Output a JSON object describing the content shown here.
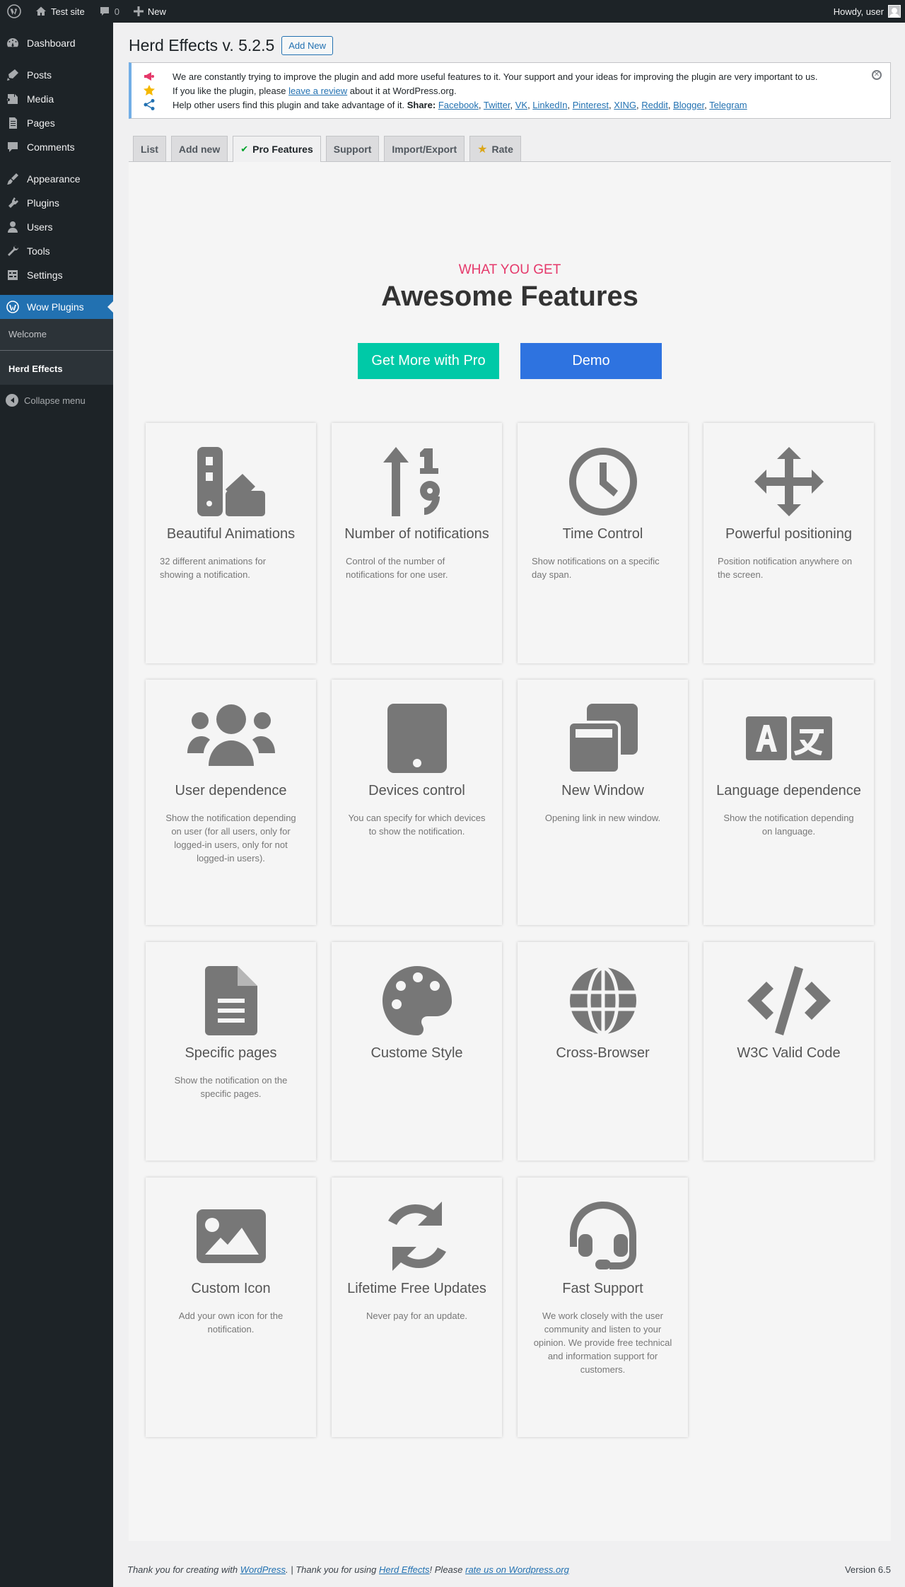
{
  "adminbar": {
    "site_name": "Test site",
    "comments_count": "0",
    "new_label": "New",
    "howdy": "Howdy, user"
  },
  "sidebar": {
    "items": [
      {
        "label": "Dashboard",
        "icon": "dashboard-icon"
      },
      {
        "label": "Posts",
        "icon": "posts-icon"
      },
      {
        "label": "Media",
        "icon": "media-icon"
      },
      {
        "label": "Pages",
        "icon": "pages-icon"
      },
      {
        "label": "Comments",
        "icon": "comments-icon"
      },
      {
        "label": "Appearance",
        "icon": "appearance-icon"
      },
      {
        "label": "Plugins",
        "icon": "plugins-icon"
      },
      {
        "label": "Users",
        "icon": "users-icon"
      },
      {
        "label": "Tools",
        "icon": "tools-icon"
      },
      {
        "label": "Settings",
        "icon": "settings-icon"
      },
      {
        "label": "Wow Plugins",
        "icon": "wow-plugins-icon"
      }
    ],
    "submenu": [
      "Welcome",
      "Herd Effects"
    ],
    "collapse": "Collapse menu"
  },
  "header": {
    "title": "Herd Effects v. 5.2.5",
    "add_new": "Add New"
  },
  "notice": {
    "line1": "We are constantly trying to improve the plugin and add more useful features to it. Your support and your ideas for improving the plugin are very important to us.",
    "line2_pre": "If you like the plugin, please ",
    "line2_link": "leave a review",
    "line2_post": " about it at WordPress.org.",
    "line3_pre": "Help other users find this plugin and take advantage of it. ",
    "share_label": "Share:",
    "share_links": [
      "Facebook",
      "Twitter",
      "VK",
      "LinkedIn",
      "Pinterest",
      "XING",
      "Reddit",
      "Blogger",
      "Telegram"
    ]
  },
  "tabs": [
    "List",
    "Add new",
    "Pro Features",
    "Support",
    "Import/Export",
    "Rate"
  ],
  "hero": {
    "eyebrow": "WHAT YOU GET",
    "title": "Awesome Features",
    "pro_button": "Get More with Pro",
    "demo_button": "Demo"
  },
  "features": [
    {
      "title": "Beautiful Animations",
      "desc": "32 different animations for showing a notification.",
      "icon": "palette-swatch-icon"
    },
    {
      "title": "Number of notifications",
      "desc": "Control of the number of notifications for one user.",
      "icon": "sort-numeric-icon"
    },
    {
      "title": "Time Control",
      "desc": "Show notifications on a specific day span.",
      "icon": "clock-icon"
    },
    {
      "title": "Powerful positioning",
      "desc": "Position notification anywhere on the screen.",
      "icon": "arrows-move-icon"
    },
    {
      "title": "User dependence",
      "desc": "Show the notification depending on user (for all users, only for logged-in users, only for not logged-in users).",
      "icon": "users-group-icon"
    },
    {
      "title": "Devices control",
      "desc": "You can specify for which devices to show the notification.",
      "icon": "tablet-icon"
    },
    {
      "title": "New Window",
      "desc": "Opening link in new window.",
      "icon": "window-restore-icon"
    },
    {
      "title": "Language dependence",
      "desc": "Show the notification depending on language.",
      "icon": "language-icon"
    },
    {
      "title": "Specific pages",
      "desc": "Show the notification on the specific pages.",
      "icon": "file-text-icon"
    },
    {
      "title": "Custome Style",
      "desc": "",
      "icon": "palette-icon"
    },
    {
      "title": "Cross-Browser",
      "desc": "",
      "icon": "globe-icon"
    },
    {
      "title": "W3C Valid Code",
      "desc": "",
      "icon": "code-icon"
    },
    {
      "title": "Custom Icon",
      "desc": "Add your own icon for the notification.",
      "icon": "image-icon"
    },
    {
      "title": "Lifetime Free Updates",
      "desc": "Never pay for an update.",
      "icon": "sync-icon"
    },
    {
      "title": "Fast Support",
      "desc": "We work closely with the user community and listen to your opinion. We provide free technical and information support for customers.",
      "icon": "headset-icon"
    }
  ],
  "footer": {
    "t1": "Thank you for creating with ",
    "wp_link": "WordPress",
    "t2": ". | Thank you for using ",
    "plugin_link": "Herd Effects",
    "t3": "! Please ",
    "rate_link": "rate us on Wordpress.org",
    "version": "Version 6.5"
  }
}
